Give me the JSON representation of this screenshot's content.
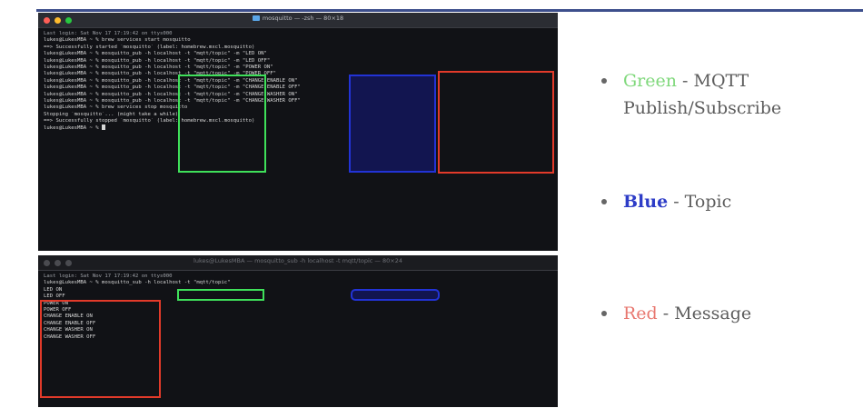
{
  "terminal_top": {
    "title": "mosquitto — -zsh — 80×18",
    "lines": [
      "Last login: Sat Nov 17 17:19:42 on ttys000",
      "lukes@LukesMBA ~ % brew services start mosquitto",
      "==> Successfully started `mosquitto` (label: homebrew.mxcl.mosquitto)",
      "lukes@LukesMBA ~ % mosquitto_pub -h localhost -t \"mqtt/topic\" -m \"LED ON\"",
      "lukes@LukesMBA ~ % mosquitto_pub -h localhost -t \"mqtt/topic\" -m \"LED OFF\"",
      "lukes@LukesMBA ~ % mosquitto_pub -h localhost -t \"mqtt/topic\" -m \"POWER ON\"",
      "lukes@LukesMBA ~ % mosquitto_pub -h localhost -t \"mqtt/topic\" -m \"POWER OFF\"",
      "lukes@LukesMBA ~ % mosquitto_pub -h localhost -t \"mqtt/topic\" -m \"CHANGE ENABLE ON\"",
      "lukes@LukesMBA ~ % mosquitto_pub -h localhost -t \"mqtt/topic\" -m \"CHANGE ENABLE OFF\"",
      "lukes@LukesMBA ~ % mosquitto_pub -h localhost -t \"mqtt/topic\" -m \"CHANGE WASHER ON\"",
      "lukes@LukesMBA ~ % mosquitto_pub -h localhost -t \"mqtt/topic\" -m \"CHANGE WASHER OFF\"",
      "lukes@LukesMBA ~ % brew services stop mosquitto",
      "Stopping `mosquitto`... (might take a while)",
      "==> Successfully stopped `mosquitto` (label: homebrew.mxcl.mosquitto)",
      "lukes@LukesMBA ~ % "
    ]
  },
  "terminal_bottom": {
    "title": "lukes@LukesMBA — mosquitto_sub -h localhost -t mqtt/topic — 80×24",
    "lines": [
      "Last login: Sat Nov 17 17:19:42 on ttys000",
      "lukes@LukesMBA ~ % mosquitto_sub -h localhost -t \"mqtt/topic\"",
      "LED ON",
      "LED OFF",
      "POWER ON",
      "POWER OFF",
      "CHANGE ENABLE ON",
      "CHANGE ENABLE OFF",
      "CHANGE WASHER ON",
      "CHANGE WASHER OFF"
    ]
  },
  "legend": [
    {
      "key": "Green",
      "desc": " - MQTT Publish/Subscribe",
      "color": "#7fd87b"
    },
    {
      "key": "Blue",
      "desc": " - Topic",
      "color": "#2d3cc7"
    },
    {
      "key": "Red",
      "desc": " - Message",
      "color": "#e8776f"
    }
  ],
  "colors": {
    "highlight_green": "#3fe05a",
    "highlight_blue": "#2233d6",
    "highlight_red": "#e23a2a",
    "terminal_bg": "#111216"
  }
}
